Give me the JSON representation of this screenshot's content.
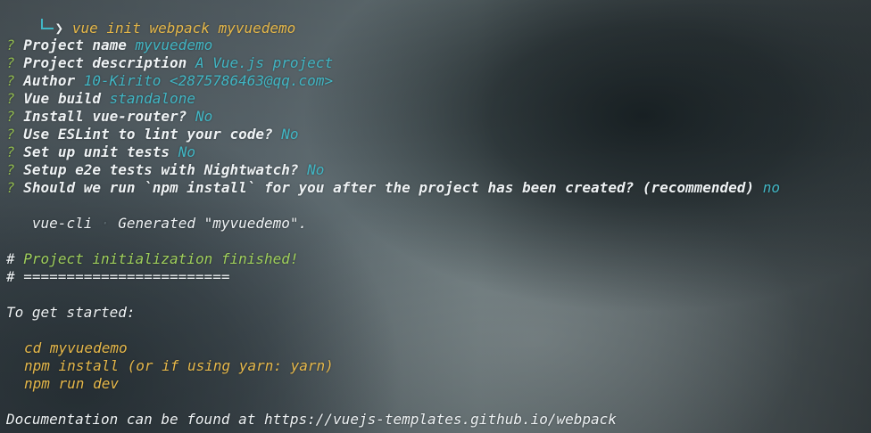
{
  "terminal": {
    "command": "vue init webpack myvuedemo",
    "prompt_symbol": "❯",
    "question_mark": "?",
    "prompts": [
      {
        "label": "Project name",
        "answer": "myvuedemo"
      },
      {
        "label": "Project description",
        "answer": "A Vue.js project"
      },
      {
        "label": "Author",
        "answer": "10-Kirito <2875786463@qq.com>"
      },
      {
        "label": "Vue build",
        "answer": "standalone"
      },
      {
        "label": "Install vue-router?",
        "answer": "No"
      },
      {
        "label": "Use ESLint to lint your code?",
        "answer": "No"
      },
      {
        "label": "Set up unit tests",
        "answer": "No"
      },
      {
        "label": "Setup e2e tests with Nightwatch?",
        "answer": "No"
      },
      {
        "label": "Should we run `npm install` for you after the project has been created? (recommended)",
        "answer": "no"
      }
    ],
    "generated": {
      "tool": "vue-cli",
      "separator": "·",
      "message": "Generated \"myvuedemo\"."
    },
    "init_done_hash": "#",
    "init_done": "Project initialization finished!",
    "rule_line": "# ========================",
    "get_started": "To get started:",
    "commands": [
      "cd myvuedemo",
      "npm install (or if using yarn: yarn)",
      "npm run dev"
    ],
    "docs": "Documentation can be found at https://vuejs-templates.github.io/webpack"
  },
  "colors": {
    "answer": "#41b6c4",
    "question": "#8fb84e",
    "success": "#9fcf5b",
    "command": "#e6b84a"
  }
}
